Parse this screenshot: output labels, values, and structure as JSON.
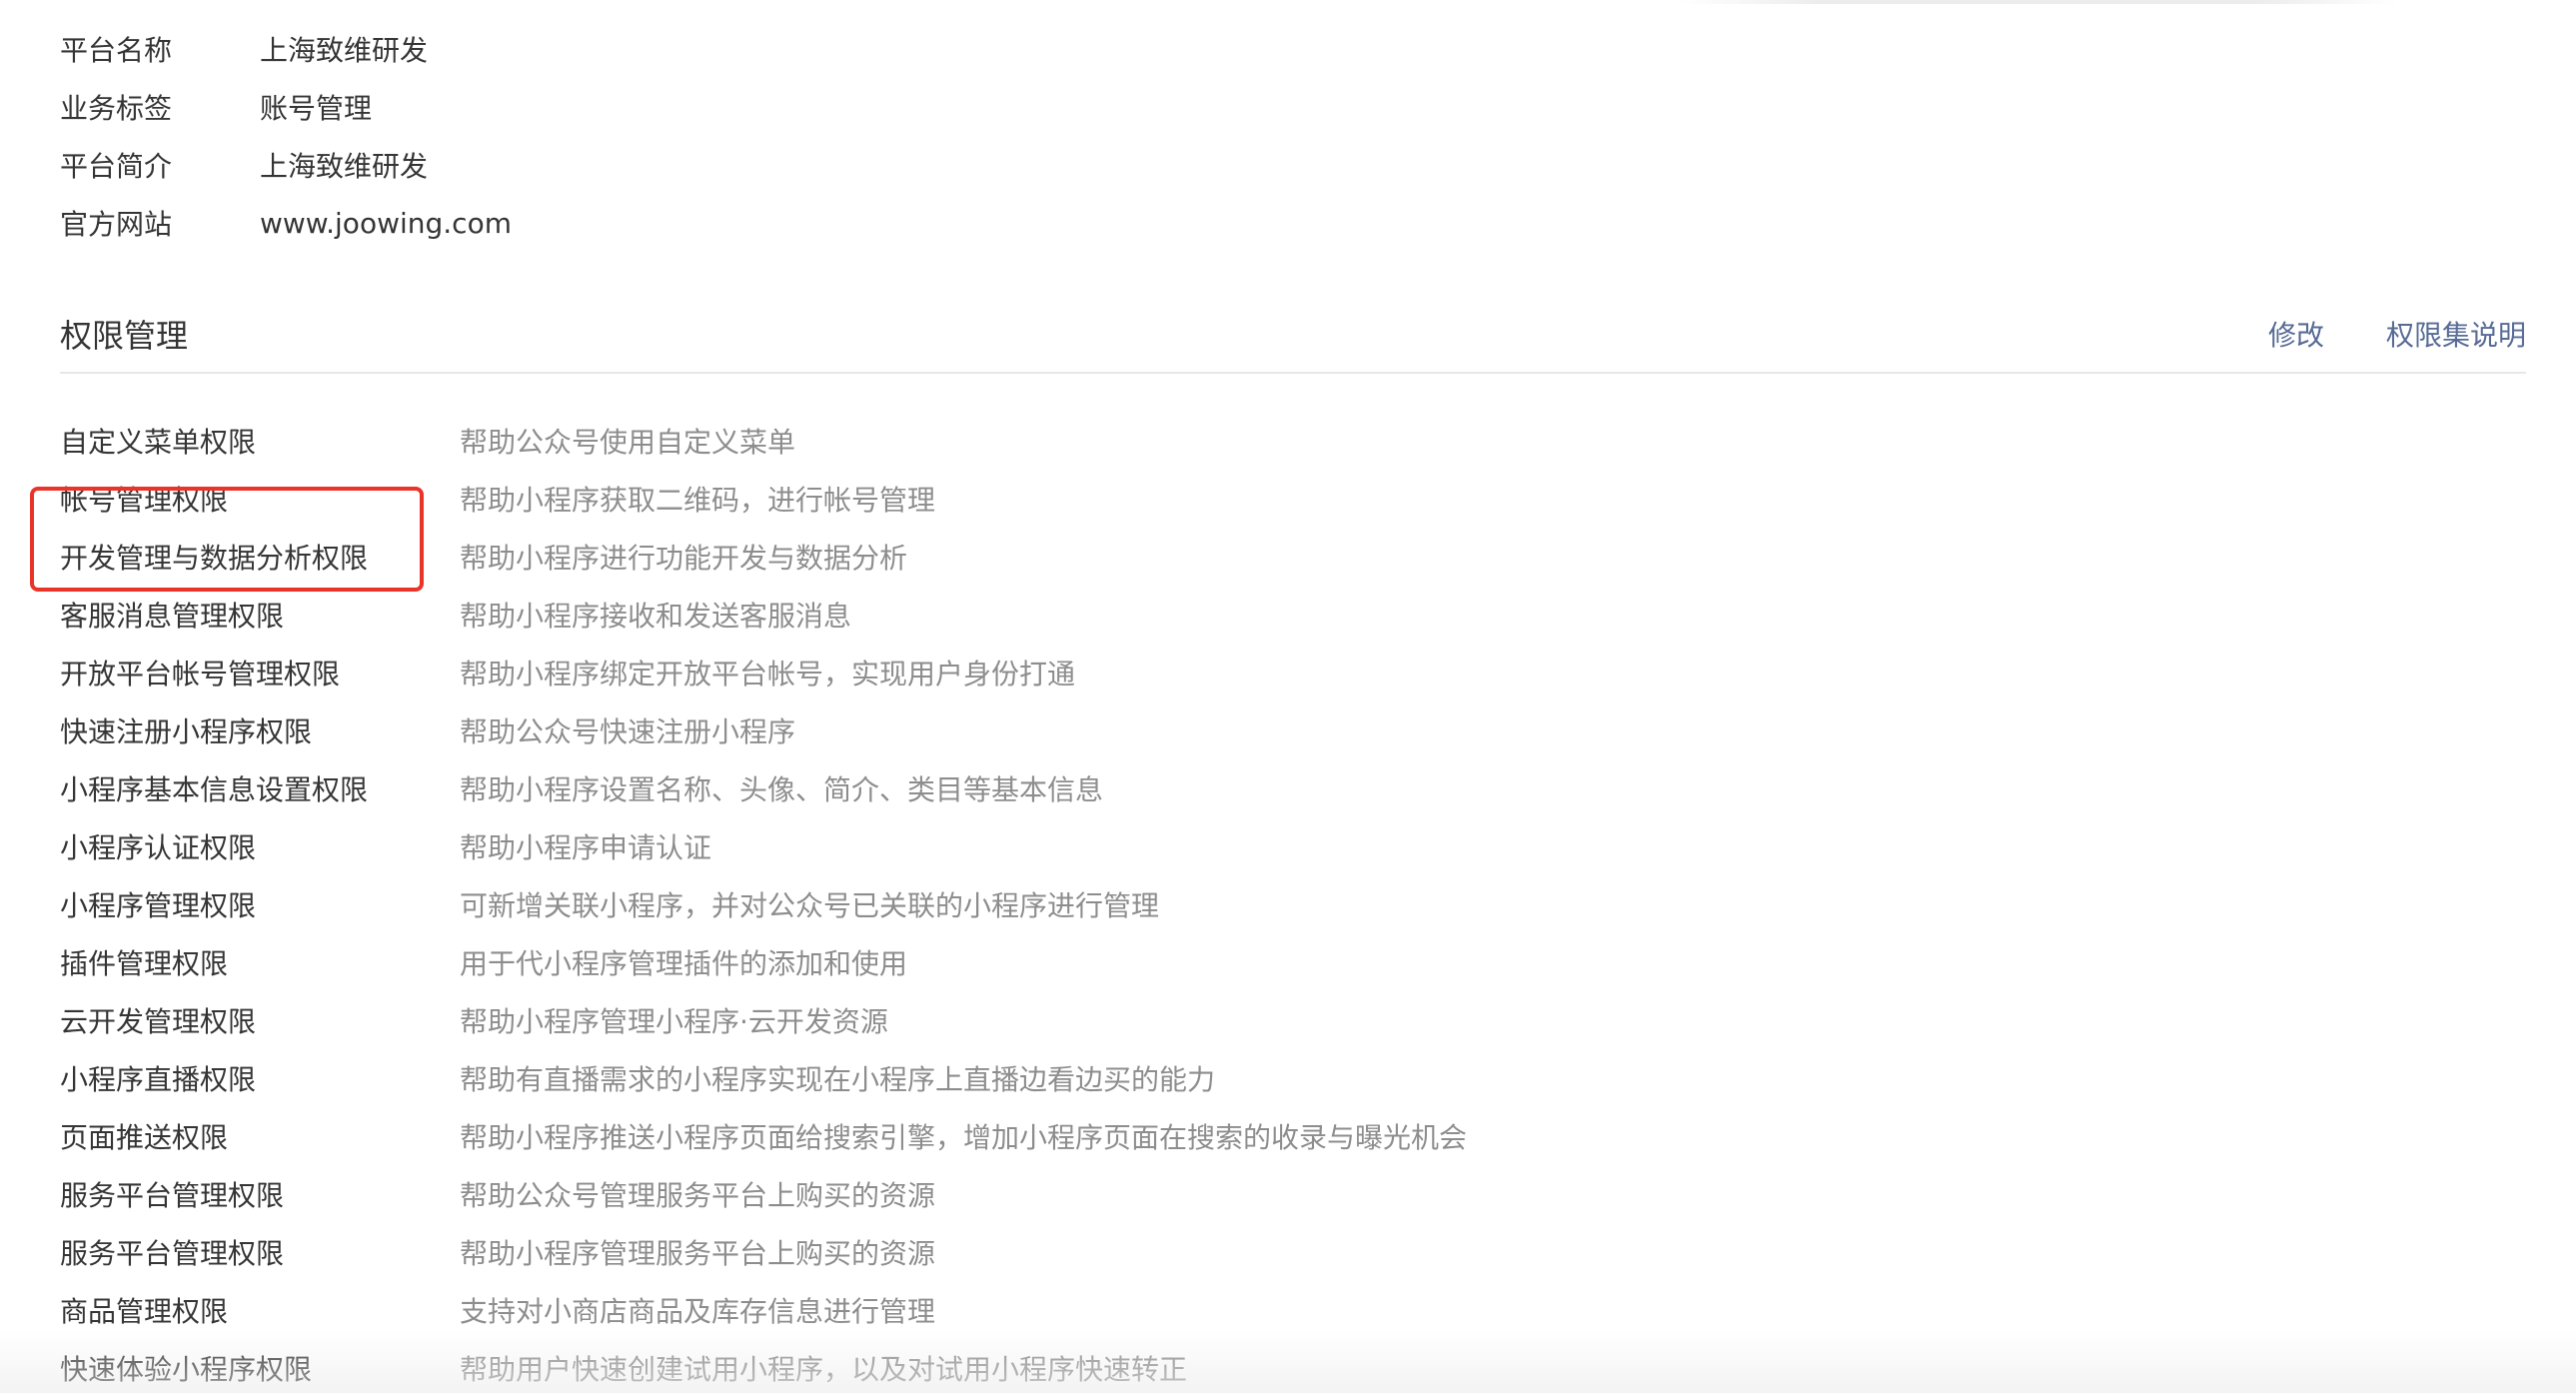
{
  "platform_info": [
    {
      "label": "平台名称",
      "value": "上海致维研发"
    },
    {
      "label": "业务标签",
      "value": "账号管理"
    },
    {
      "label": "平台简介",
      "value": "上海致维研发"
    },
    {
      "label": "官方网站",
      "value": "www.joowing.com"
    }
  ],
  "permissions_section": {
    "title": "权限管理",
    "edit_link": "修改",
    "explain_link": "权限集说明"
  },
  "permissions": [
    {
      "name": "自定义菜单权限",
      "desc": "帮助公众号使用自定义菜单"
    },
    {
      "name": "帐号管理权限",
      "desc": "帮助小程序获取二维码，进行帐号管理"
    },
    {
      "name": "开发管理与数据分析权限",
      "desc": "帮助小程序进行功能开发与数据分析"
    },
    {
      "name": "客服消息管理权限",
      "desc": "帮助小程序接收和发送客服消息"
    },
    {
      "name": "开放平台帐号管理权限",
      "desc": "帮助小程序绑定开放平台帐号，实现用户身份打通"
    },
    {
      "name": "快速注册小程序权限",
      "desc": "帮助公众号快速注册小程序"
    },
    {
      "name": "小程序基本信息设置权限",
      "desc": "帮助小程序设置名称、头像、简介、类目等基本信息"
    },
    {
      "name": "小程序认证权限",
      "desc": "帮助小程序申请认证"
    },
    {
      "name": "小程序管理权限",
      "desc": "可新增关联小程序，并对公众号已关联的小程序进行管理"
    },
    {
      "name": "插件管理权限",
      "desc": "用于代小程序管理插件的添加和使用"
    },
    {
      "name": "云开发管理权限",
      "desc": "帮助小程序管理小程序·云开发资源"
    },
    {
      "name": "小程序直播权限",
      "desc": "帮助有直播需求的小程序实现在小程序上直播边看边买的能力"
    },
    {
      "name": "页面推送权限",
      "desc": "帮助小程序推送小程序页面给搜索引擎，增加小程序页面在搜索的收录与曝光机会"
    },
    {
      "name": "服务平台管理权限",
      "desc": "帮助公众号管理服务平台上购买的资源"
    },
    {
      "name": "服务平台管理权限",
      "desc": "帮助小程序管理服务平台上购买的资源"
    },
    {
      "name": "商品管理权限",
      "desc": "支持对小商店商品及库存信息进行管理"
    },
    {
      "name": "快速体验小程序权限",
      "desc": "帮助用户快速创建试用小程序，以及对试用小程序快速转正"
    }
  ],
  "colors": {
    "link": "#576b95",
    "highlight": "#e9342a",
    "desc_text": "#8d8d8d"
  }
}
